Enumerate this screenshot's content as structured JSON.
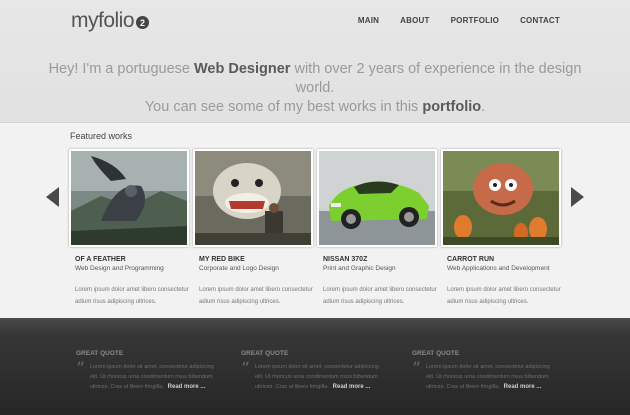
{
  "header": {
    "logo_text": "myfolio",
    "logo_badge": "2",
    "nav": [
      "MAIN",
      "ABOUT",
      "PORTFOLIO",
      "CONTACT"
    ]
  },
  "intro": {
    "part1": "Hey! I'm a portuguese ",
    "bold1": "Web Designer",
    "part2": " with over 2 years of experience in the design world.",
    "part3": "You can see some of my best works in this ",
    "bold2": "portfolio",
    "part4": "."
  },
  "featured": {
    "title": "Featured works",
    "works": [
      {
        "title": "OF A FEATHER",
        "subtitle": "Web Design and Programming",
        "desc_line1": "Lorem ipsum dolor amet libero consectetur",
        "desc_line2": "adium risus adipiscing ultrices."
      },
      {
        "title": "MY RED BIKE",
        "subtitle": "Corporate and Logo Design",
        "desc_line1": "Lorem ipsum dolor amet libero consectetur",
        "desc_line2": "adium risus adipiscing ultrices."
      },
      {
        "title": "NISSAN 370Z",
        "subtitle": "Print and Graphic Design",
        "desc_line1": "Lorem ipsum dolor amet libero consectetur",
        "desc_line2": "adium risus adipiscing ultrices."
      },
      {
        "title": "CARROT RUN",
        "subtitle": "Web Applications and Development",
        "desc_line1": "Lorem ipsum dolor amet libero consectetur",
        "desc_line2": "adium risus adipiscing ultrices."
      }
    ]
  },
  "footer": {
    "quotes": [
      {
        "title": "GREAT QUOTE",
        "line1": "Lorem ipsum dolor sit amet, consectetur adipiscing",
        "line2": "elit. Ut rhoncus urna condimentum risus bibendum",
        "line3": "ultrices. Cras ut libero fringilla.",
        "read_more": "Read more ..."
      },
      {
        "title": "GREAT QUOTE",
        "line1": "Lorem ipsum dolor sit amet, consectetur adipiscing",
        "line2": "elit. Ut rhoncus urna condimentum risus bibendum",
        "line3": "ultrices. Cras ut libero fringilla.",
        "read_more": "Read more ..."
      },
      {
        "title": "GREAT QUOTE",
        "line1": "Lorem ipsum dolor sit amet, consectetur adipiscing",
        "line2": "elit. Ut rhoncus urna condimentum risus bibendum",
        "line3": "ultrices. Cras ut libero fringilla.",
        "read_more": "Read more ..."
      }
    ]
  },
  "icons": {
    "prev": "chevron-left-icon",
    "next": "chevron-right-icon",
    "quote": "quote-icon"
  }
}
